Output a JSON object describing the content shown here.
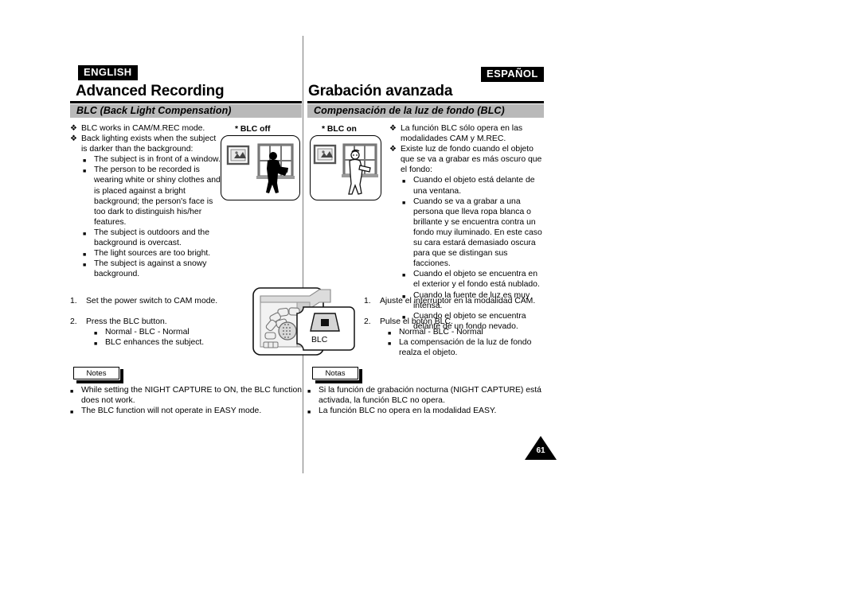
{
  "page": {
    "number": "61",
    "english_badge": "ENGLISH",
    "spanish_badge": "ESPAÑOL"
  },
  "english": {
    "chapter_title": "Advanced Recording",
    "section_title": "BLC (Back Light Compensation)",
    "intro": [
      {
        "level": 1,
        "marker": "diamond",
        "text": "BLC works in CAM/M.REC mode."
      },
      {
        "level": 1,
        "marker": "diamond",
        "text": "Back lighting exists when the subject is darker than the background:"
      },
      {
        "level": 2,
        "marker": "square",
        "text": "The subject is in front of a window."
      },
      {
        "level": 2,
        "marker": "square",
        "text": "The person to be recorded is wearing white or shiny clothes and is placed against a bright background; the person's face is too dark to distinguish his/her features."
      },
      {
        "level": 2,
        "marker": "square",
        "text": "The subject is outdoors and the background is overcast."
      },
      {
        "level": 2,
        "marker": "square",
        "text": "The light sources are too bright."
      },
      {
        "level": 2,
        "marker": "square",
        "text": "The subject is against a snowy background."
      }
    ],
    "steps": [
      {
        "num": "1.",
        "text": "Set the power switch to CAM mode.",
        "sub": []
      },
      {
        "num": "2.",
        "text": "Press the BLC button.",
        "sub": [
          "Normal - BLC - Normal",
          "BLC enhances the subject."
        ]
      }
    ],
    "notes_label": "Notes",
    "notes": [
      "While setting the NIGHT CAPTURE to ON, the BLC function does not work.",
      "The BLC function will not operate in EASY mode."
    ]
  },
  "spanish": {
    "chapter_title": "Grabación avanzada",
    "section_title": "Compensación de la luz de fondo (BLC)",
    "intro": [
      {
        "level": 1,
        "marker": "diamond",
        "text": "La función BLC sólo opera en las modalidades CAM y M.REC."
      },
      {
        "level": 1,
        "marker": "diamond",
        "text": "Existe luz de fondo cuando el objeto que se va a grabar es más oscuro que el fondo:"
      },
      {
        "level": 2,
        "marker": "square",
        "text": "Cuando el objeto está delante de una ventana."
      },
      {
        "level": 2,
        "marker": "square",
        "text": "Cuando se va a grabar a una persona que lleva ropa blanca o brillante y se encuentra contra un fondo muy iluminado. En este caso su cara estará demasiado oscura para que se distingan sus facciones."
      },
      {
        "level": 2,
        "marker": "square",
        "text": "Cuando el objeto se encuentra en el exterior y el fondo está nublado."
      },
      {
        "level": 2,
        "marker": "square",
        "text": "Cuando la fuente de luz es muy intensa."
      },
      {
        "level": 2,
        "marker": "square",
        "text": "Cuando el objeto se encuentra delante de un fondo nevado."
      }
    ],
    "steps": [
      {
        "num": "1.",
        "text": "Ajuste el interruptor en la modalidad CAM.",
        "sub": []
      },
      {
        "num": "2.",
        "text": "Pulse el botón BLC.",
        "sub": [
          "Normal - BLC - Normal",
          "La compensación de la luz de fondo realza el objeto."
        ]
      }
    ],
    "notes_label": "Notas",
    "notes": [
      "Si la función de grabación nocturna (NIGHT CAPTURE) está activada, la función BLC no opera.",
      "La función BLC no opera en la modalidad EASY."
    ]
  },
  "illustrations": {
    "blc_off_label": "* BLC off",
    "blc_on_label": "* BLC on",
    "camcorder_button_label": "BLC"
  },
  "markers": {
    "diamond": "❖",
    "square": "■"
  },
  "colors": {
    "section_bar": "#b9b9b9",
    "badge_bg": "#000000",
    "rule": "#000000"
  }
}
